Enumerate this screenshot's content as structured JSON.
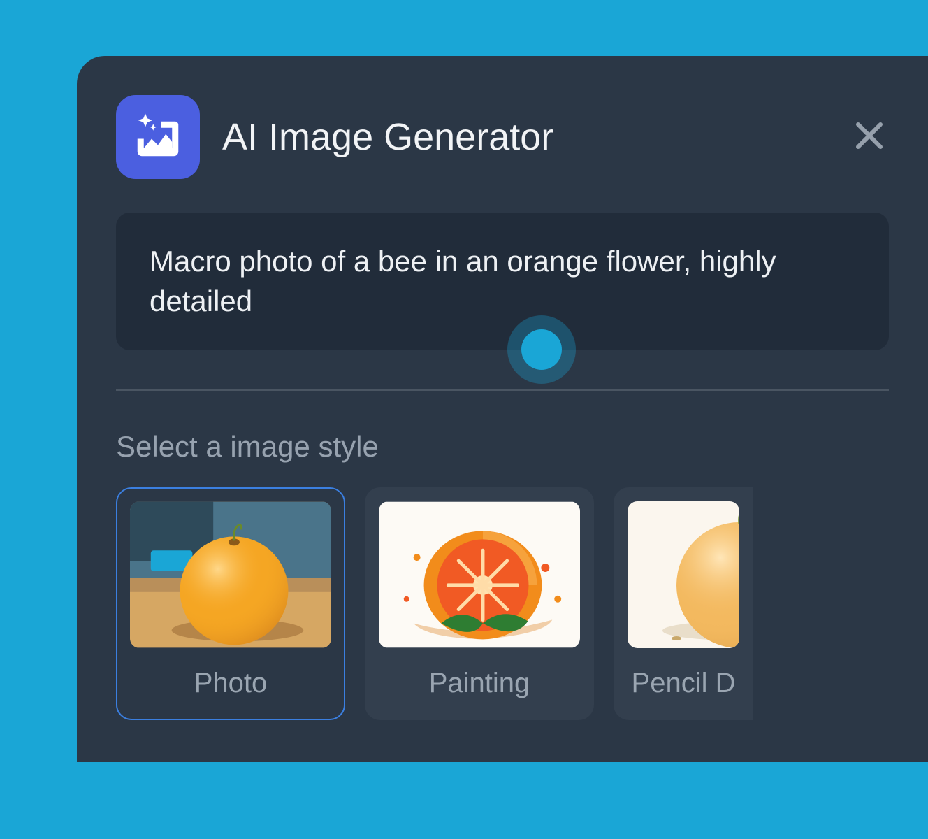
{
  "header": {
    "title": "AI Image Generator"
  },
  "prompt": {
    "value": "Macro photo of a bee in an orange flower, highly detailed"
  },
  "style_section": {
    "label": "Select a image style",
    "options": [
      {
        "label": "Photo",
        "selected": true
      },
      {
        "label": "Painting",
        "selected": false
      },
      {
        "label": "Pencil D",
        "selected": false
      }
    ]
  }
}
